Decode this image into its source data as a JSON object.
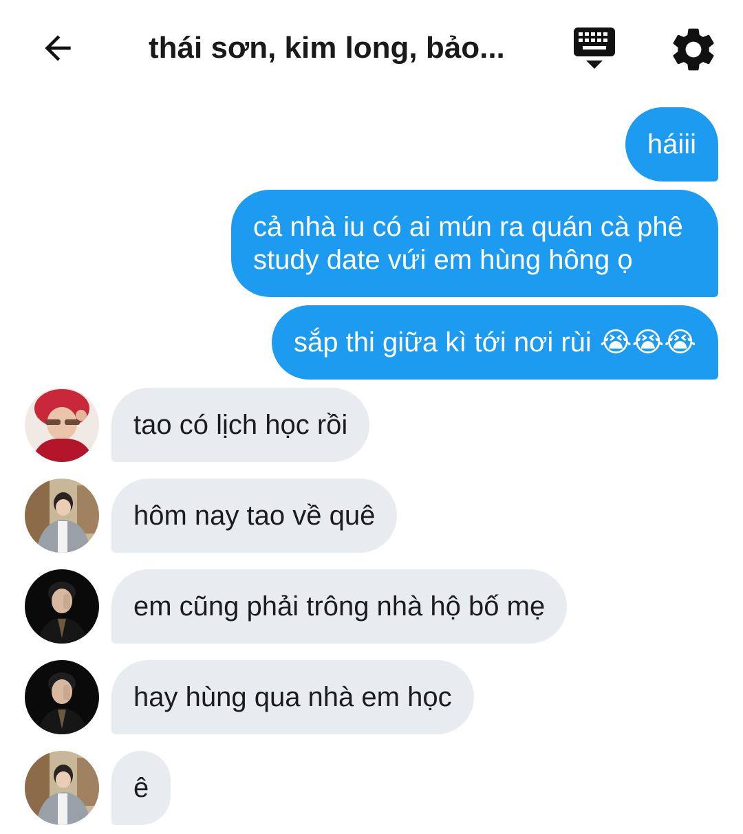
{
  "header": {
    "title": "thái sơn, kim long, bảo...",
    "back_icon": "arrow-left-icon",
    "keyboard_icon": "keyboard-icon",
    "settings_icon": "gear-icon"
  },
  "colors": {
    "outgoing_bubble": "#1d9bf0",
    "incoming_bubble": "#e8ebef",
    "text_dark": "#1c1c1e",
    "text_light": "#ffffff"
  },
  "messages": [
    {
      "direction": "outgoing",
      "text": "háiii"
    },
    {
      "direction": "outgoing",
      "text": "cả nhà iu có ai mún ra quán cà phê study date vứi em hùng hông ọ"
    },
    {
      "direction": "outgoing",
      "text": "sắp thi giữa kì tới nơi rùi",
      "emoji": "😭😭😭"
    },
    {
      "direction": "incoming",
      "sender_avatar": "avatar-red-hair",
      "text": "tao có lịch học rồi"
    },
    {
      "direction": "incoming",
      "sender_avatar": "avatar-grey-cardigan",
      "text": "hôm nay tao về quê"
    },
    {
      "direction": "incoming",
      "sender_avatar": "avatar-black-suit",
      "text": "em cũng phải trông nhà hộ bố mẹ"
    },
    {
      "direction": "incoming",
      "sender_avatar": "avatar-black-suit",
      "text": "hay hùng qua nhà em học"
    },
    {
      "direction": "incoming",
      "sender_avatar": "avatar-grey-cardigan",
      "text": "ê"
    }
  ]
}
